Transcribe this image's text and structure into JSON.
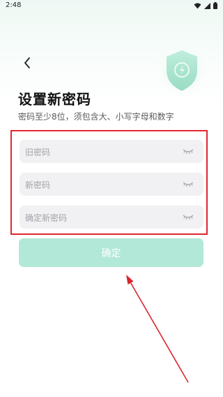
{
  "status_bar": {
    "time": "2:48",
    "icons": [
      "wifi-icon",
      "signal-icon",
      "battery-icon"
    ]
  },
  "header": {
    "back_icon": "chevron-left-icon",
    "illustration_icon": "shield-icon"
  },
  "page": {
    "title": "设置新密码",
    "subtitle": "密码至少8位，须包含大、小写字母和数字"
  },
  "form": {
    "fields": [
      {
        "placeholder": "旧密码",
        "value": "",
        "toggle_icon": "eye-closed-icon"
      },
      {
        "placeholder": "新密码",
        "value": "",
        "toggle_icon": "eye-closed-icon"
      },
      {
        "placeholder": "确定新密码",
        "value": "",
        "toggle_icon": "eye-closed-icon"
      }
    ],
    "submit_label": "确定"
  },
  "colors": {
    "accent": "#b2e8d8",
    "shield": "#9fe0c8",
    "annotation": "#e0262f",
    "input_bg": "#f1f1f4"
  }
}
